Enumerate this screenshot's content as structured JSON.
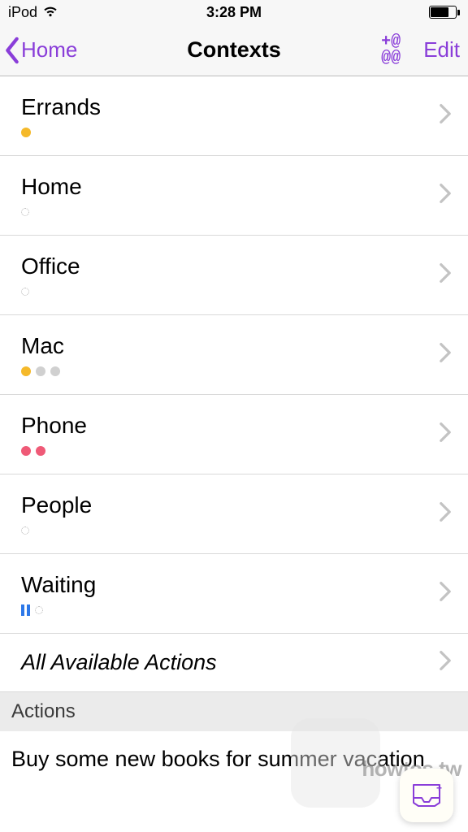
{
  "status": {
    "device": "iPod",
    "time": "3:28 PM"
  },
  "nav": {
    "back_label": "Home",
    "title": "Contexts",
    "add_icon": "+@\n@@",
    "edit_label": "Edit"
  },
  "contexts": [
    {
      "label": "Errands",
      "indicators": [
        {
          "type": "dot",
          "color": "orange"
        }
      ]
    },
    {
      "label": "Home",
      "indicators": [
        {
          "type": "empty"
        }
      ]
    },
    {
      "label": "Office",
      "indicators": [
        {
          "type": "empty"
        }
      ]
    },
    {
      "label": "Mac",
      "indicators": [
        {
          "type": "dot",
          "color": "orange"
        },
        {
          "type": "dot",
          "color": "grey"
        },
        {
          "type": "dot",
          "color": "grey"
        }
      ]
    },
    {
      "label": "Phone",
      "indicators": [
        {
          "type": "dot",
          "color": "red"
        },
        {
          "type": "dot",
          "color": "red"
        }
      ]
    },
    {
      "label": "People",
      "indicators": [
        {
          "type": "empty"
        }
      ]
    },
    {
      "label": "Waiting",
      "indicators": [
        {
          "type": "pause"
        },
        {
          "type": "empty"
        }
      ]
    }
  ],
  "all_actions_label": "All Available Actions",
  "section_header": "Actions",
  "action_item": "Buy some new books for summer vacation",
  "watermark": "howtos.tw",
  "colors": {
    "accent": "#8a3ed9"
  }
}
